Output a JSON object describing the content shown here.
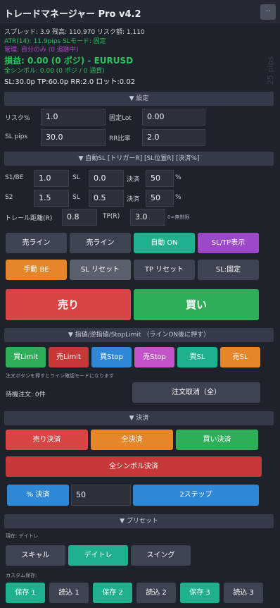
{
  "title": "トレードマネージャー Pro v4.2",
  "minimize_label": "..",
  "watermark": "25 pips",
  "info": {
    "line1": "スプレッド: 3.9  残高: 110,970  リスク額: 1,110",
    "line2": "ATR(14): 11.9pips  SLモード: 固定",
    "line3": "管理: 自分のみ (0 追跡中)",
    "pnl": "損益: 0.00 (0 ポジ) - EURUSD",
    "all_symbol": "全シンボル: 0.00 (0 ポジ / 0 通貨)",
    "levels": "SL:30.0p  TP:60.0p  RR:2.0  ロット:0.02"
  },
  "settings": {
    "header": "▼ 設定",
    "risk_label": "リスク%",
    "risk_value": "1.0",
    "fixed_lot_label": "固定Lot",
    "fixed_lot_value": "0.00",
    "sl_label": "SL pips",
    "sl_value": "30.0",
    "rr_label": "RR比率",
    "rr_value": "2.0"
  },
  "auto_sl": {
    "header": "▼ 自動SL [トリガーR] [SL位置R] [決済%]",
    "s1_label": "S1/BE",
    "s1_trigger": "1.0",
    "s1_sl_label": "SL",
    "s1_sl": "0.0",
    "s1_close_label": "決済",
    "s1_close": "50",
    "s1_pct": "%",
    "s2_label": "S2",
    "s2_trigger": "1.5",
    "s2_sl_label": "SL",
    "s2_sl": "0.5",
    "s2_close_label": "決済",
    "s2_close": "50",
    "s2_pct": "%",
    "trail_label": "トレール距離(R)",
    "trail_value": "0.8",
    "tp_label": "TP(R)",
    "tp_value": "3.0",
    "tp_note": "0=無制限"
  },
  "controls": {
    "sell_line": "売ライン",
    "buy_line": "売ライン",
    "auto_on": "自動 ON",
    "sltp_show": "SL/TP表示",
    "manual_be": "手動 BE",
    "sl_reset": "SL リセット",
    "tp_reset": "TP リセット",
    "sl_fixed": "SL:固定"
  },
  "trade": {
    "sell": "売り",
    "buy": "買い"
  },
  "pending": {
    "header": "▼ 指値/逆指値/StopLimit  （ラインON後に押す）",
    "buy_limit": "買Limit",
    "sell_limit": "売Limit",
    "buy_stop": "買Stop",
    "sell_stop": "売Stop",
    "buy_sl": "買SL",
    "sell_sl": "売SL",
    "note": "注文ボタンを押すとライン確認モードになります",
    "waiting": "待機注文: 0件",
    "cancel": "注文取消（全）"
  },
  "close": {
    "header": "▼ 決済",
    "sell_close": "売り決済",
    "all_close": "全決済",
    "buy_close": "買い決済",
    "all_symbol_close": "全シンボル決済",
    "pct_close": "% 決済",
    "pct_value": "50",
    "two_step": "2ステップ"
  },
  "presets": {
    "header": "▼ プリセット",
    "current": "現在: デイトレ",
    "scalp": "スキャル",
    "daytrade": "デイトレ",
    "swing": "スイング",
    "custom_label": "カスタム保存:",
    "save1": "保存 1",
    "load1": "読込 1",
    "save2": "保存 2",
    "load2": "読込 2",
    "save3": "保存 3",
    "load3": "読込 3"
  }
}
